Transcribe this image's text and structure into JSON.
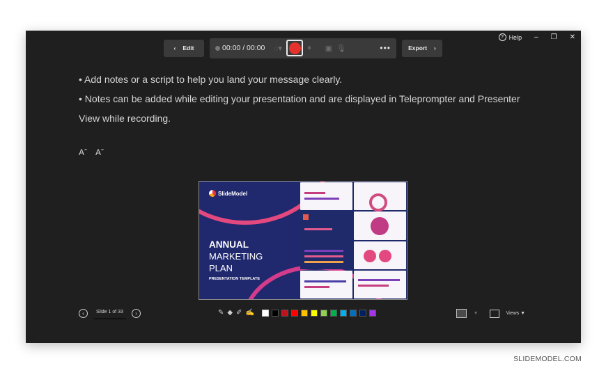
{
  "window": {
    "help_label": "Help",
    "minimize_glyph": "–",
    "restore_glyph": "❐",
    "close_glyph": "✕"
  },
  "toolbar": {
    "edit_label": "Edit",
    "timer": "00:00 / 00:00",
    "export_label": "Export"
  },
  "notes": {
    "lines": [
      "• Add notes or a script to help you land your message clearly.",
      "• Notes can be added while editing your presentation and are displayed in Teleprompter and Presenter View while recording."
    ],
    "increase_font_label": "Aˆ",
    "decrease_font_label": "Aˇ"
  },
  "slide": {
    "logo_text": "SlideModel",
    "title_line1": "ANNUAL",
    "title_line2": "MARKETING",
    "title_line3": "PLAN",
    "subtitle": "PRESENTATION TEMPLATE"
  },
  "footer": {
    "slide_counter": "Slide 1 of 33",
    "views_label": "Views ▼",
    "ink_colors": [
      "#ffffff",
      "#000000",
      "#c0121b",
      "#ff0000",
      "#ffc000",
      "#ffff00",
      "#92d050",
      "#00b050",
      "#00b0f0",
      "#0070c0",
      "#002060",
      "#a236e8"
    ]
  },
  "brand": "SLIDEMODEL.COM",
  "icons": {
    "back": "chevron-left-icon",
    "forward": "chevron-right-icon",
    "record": "record-icon",
    "pause": "pause-icon",
    "camera": "camera-off-icon",
    "mic": "mic-off-icon",
    "more": "more-icon"
  }
}
